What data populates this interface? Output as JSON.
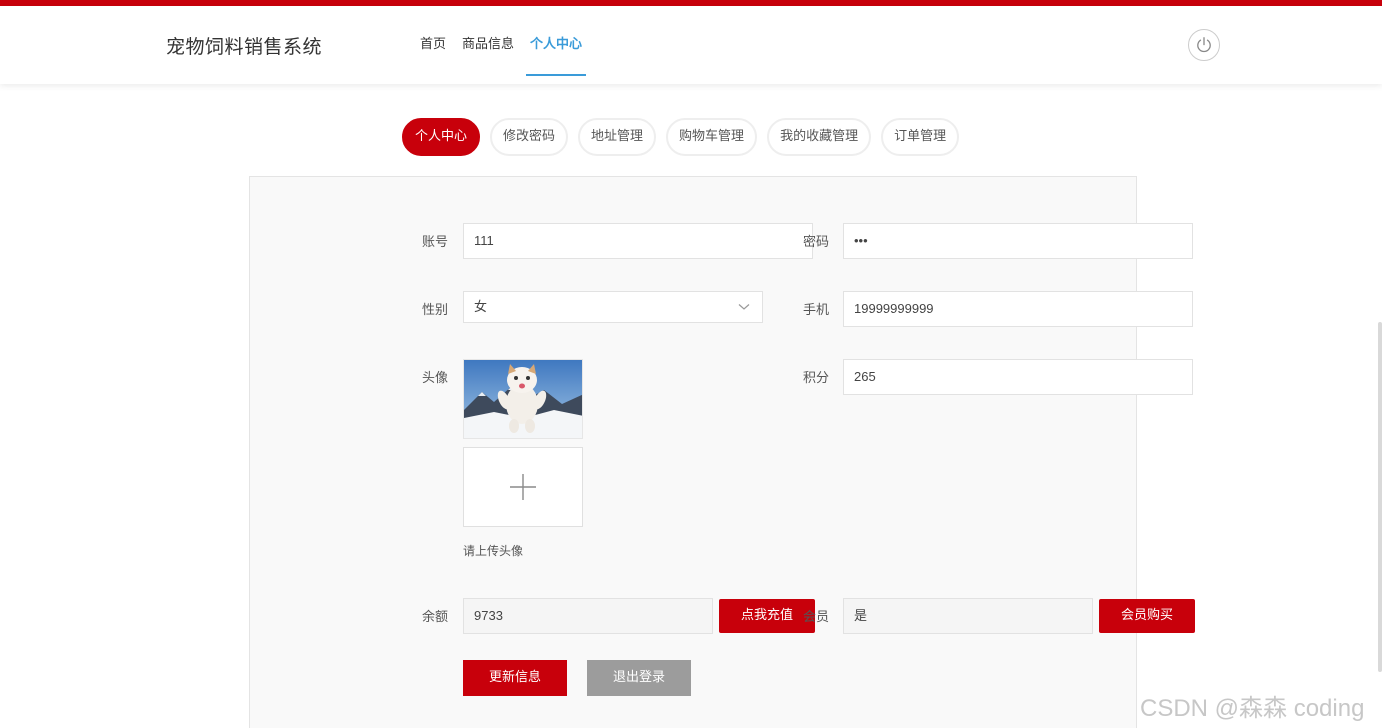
{
  "header": {
    "brand": "宠物饲料销售系统",
    "nav": [
      {
        "label": "首页",
        "active": false
      },
      {
        "label": "商品信息",
        "active": false
      },
      {
        "label": "个人中心",
        "active": true
      }
    ],
    "power_icon": "power-icon"
  },
  "tabs": [
    {
      "label": "个人中心",
      "active": true
    },
    {
      "label": "修改密码",
      "active": false
    },
    {
      "label": "地址管理",
      "active": false
    },
    {
      "label": "购物车管理",
      "active": false
    },
    {
      "label": "我的收藏管理",
      "active": false
    },
    {
      "label": "订单管理",
      "active": false
    }
  ],
  "form": {
    "account_label": "账号",
    "account_value": "111",
    "password_label": "密码",
    "password_value": "•••",
    "gender_label": "性别",
    "gender_value": "女",
    "phone_label": "手机",
    "phone_value": "19999999999",
    "avatar_label": "头像",
    "upload_hint": "请上传头像",
    "points_label": "积分",
    "points_value": "265",
    "balance_label": "余额",
    "balance_value": "9733",
    "recharge_button": "点我充值",
    "member_label": "会员",
    "member_value": "是",
    "buy_member_button": "会员购买",
    "update_button": "更新信息",
    "logout_button": "退出登录"
  },
  "watermark": "CSDN @森森 coding",
  "colors": {
    "primary": "#c8000b",
    "nav_active": "#3a9bd9",
    "secondary_button": "#9c9c9c"
  }
}
